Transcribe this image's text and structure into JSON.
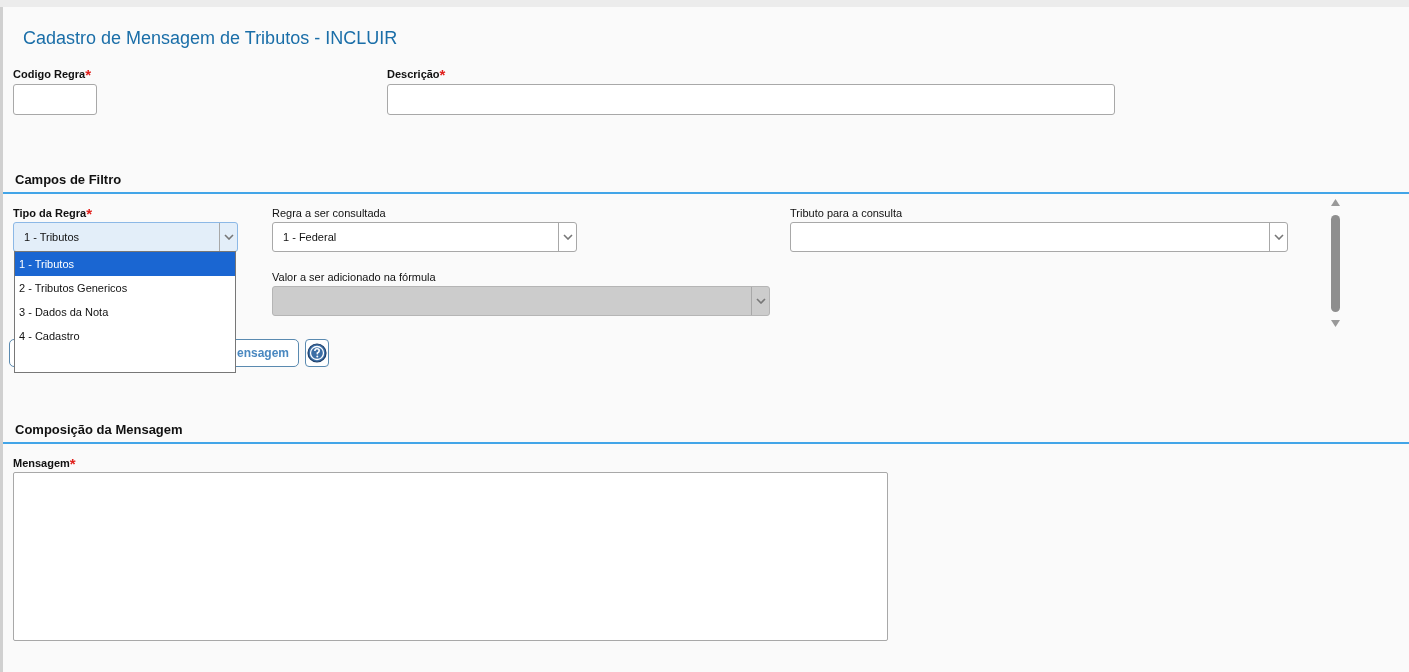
{
  "page": {
    "title": "Cadastro de Mensagem de Tributos - INCLUIR"
  },
  "header_fields": [
    {
      "label": "Codigo Regra",
      "required_mark": "*"
    },
    {
      "label": "Descrição",
      "required_mark": "*"
    }
  ],
  "filter_section": {
    "heading": "Campos de Filtro",
    "selects": [
      {
        "label": "Tipo da Regra",
        "required_mark": "*",
        "value": "1 - Tributos",
        "expanded": true,
        "disabled": false,
        "options": [
          {
            "label": "1 - Tributos",
            "selected": true
          },
          {
            "label": "2 - Tributos Genericos",
            "selected": false
          },
          {
            "label": "3 - Dados da Nota",
            "selected": false
          },
          {
            "label": "4 - Cadastro",
            "selected": false
          }
        ]
      },
      {
        "label": "Regra a ser consultada",
        "value": "1 - Federal",
        "expanded": false,
        "disabled": false
      },
      {
        "label": "Tributo para a consulta",
        "expanded": false,
        "disabled": false
      },
      {
        "label": "Valor a ser adicionado na fórmula",
        "expanded": false,
        "disabled": true
      }
    ],
    "button_text": "ensagem"
  },
  "message_section": {
    "heading": "Composição da Mensagem",
    "field_label": "Mensagem",
    "required_mark": "*"
  }
}
